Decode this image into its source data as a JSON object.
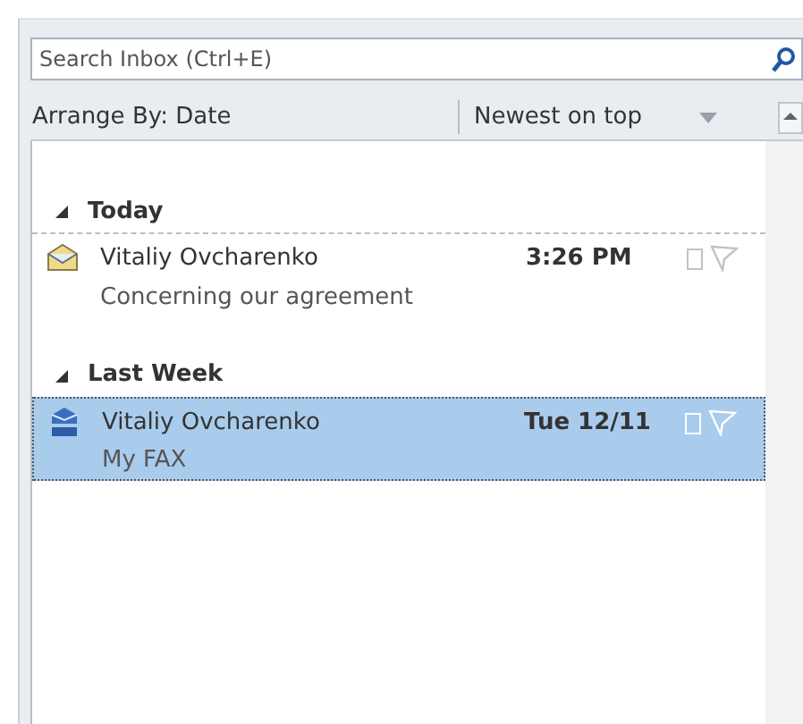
{
  "search": {
    "placeholder": "Search Inbox (Ctrl+E)"
  },
  "arrange": {
    "label": "Arrange By: Date",
    "order": "Newest on top"
  },
  "groups": [
    {
      "label": "Today",
      "expanded": true,
      "items": [
        {
          "kind": "mail",
          "sender": "Vitaliy Ovcharenko",
          "time": "3:26 PM",
          "subject": "Concerning our agreement",
          "selected": false
        }
      ]
    },
    {
      "label": "Last Week",
      "expanded": true,
      "items": [
        {
          "kind": "fax",
          "sender": "Vitaliy Ovcharenko",
          "time": "Tue 12/11",
          "subject": "My FAX",
          "selected": true
        }
      ]
    }
  ]
}
